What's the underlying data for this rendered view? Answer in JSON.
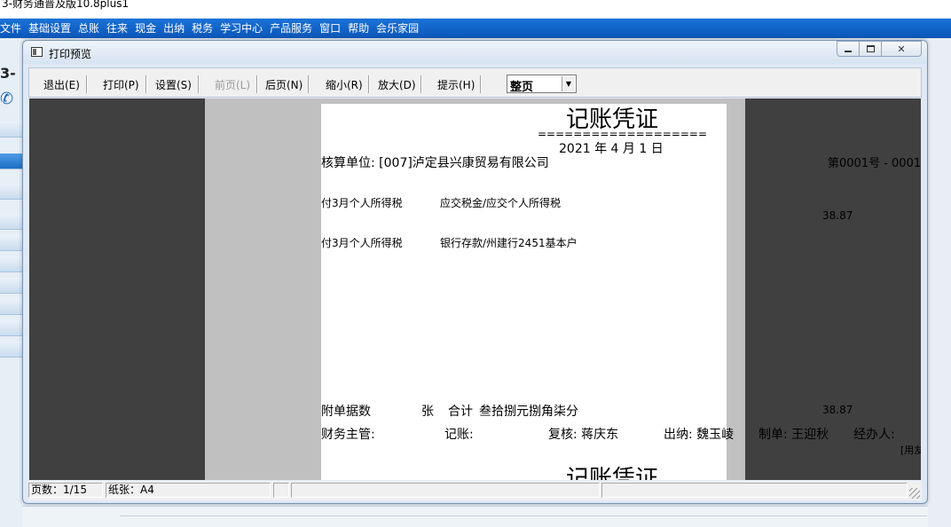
{
  "app": {
    "title": "3-财务通普及版10.8plus1",
    "menu": [
      "文件",
      "基础设置",
      "总账",
      "往来",
      "现金",
      "出纳",
      "税务",
      "学习中心",
      "产品服务",
      "窗口",
      "帮助",
      "会乐家园"
    ],
    "logo_text": "3-"
  },
  "window": {
    "title": "打印预览",
    "toolbar": {
      "exit": "退出(E)",
      "print": "打印(P)",
      "settings": "设置(S)",
      "prev": "前页(L)",
      "next": "后页(N)",
      "zoom_out": "缩小(R)",
      "zoom_in": "放大(D)",
      "hint": "提示(H)",
      "page_mode": "整页"
    },
    "status": {
      "pages": "页数：1/15",
      "paper": "纸张：A4"
    }
  },
  "voucher": {
    "title": "记账凭证",
    "underline": "===================",
    "date": "2021 年  4  月  1 日",
    "unit": "核算单位: [007]泸定县兴康贸易有限公司",
    "number": "第0001号 - 0001",
    "rows": [
      {
        "summary": "付3月个人所得税",
        "account": "应交税金/应交个人所得税",
        "amount": "38.87"
      },
      {
        "summary": "付3月个人所得税",
        "account": "银行存款/州建行2451基本户",
        "amount": ""
      }
    ],
    "attach": "附单据数",
    "zhang": "张",
    "total_label": "合计",
    "total_words": "叁拾捌元捌角柒分",
    "total_amount": "38.87",
    "finance_manager": "财务主管:",
    "bookkeeper": "记账:",
    "reviewer": "复核: 蒋庆东",
    "cashier": "出纳: 魏玉崚",
    "maker": "制单: 王迎秋",
    "handler": "经办人:",
    "edge_text": "[用友",
    "next_title": "记账凭证"
  }
}
